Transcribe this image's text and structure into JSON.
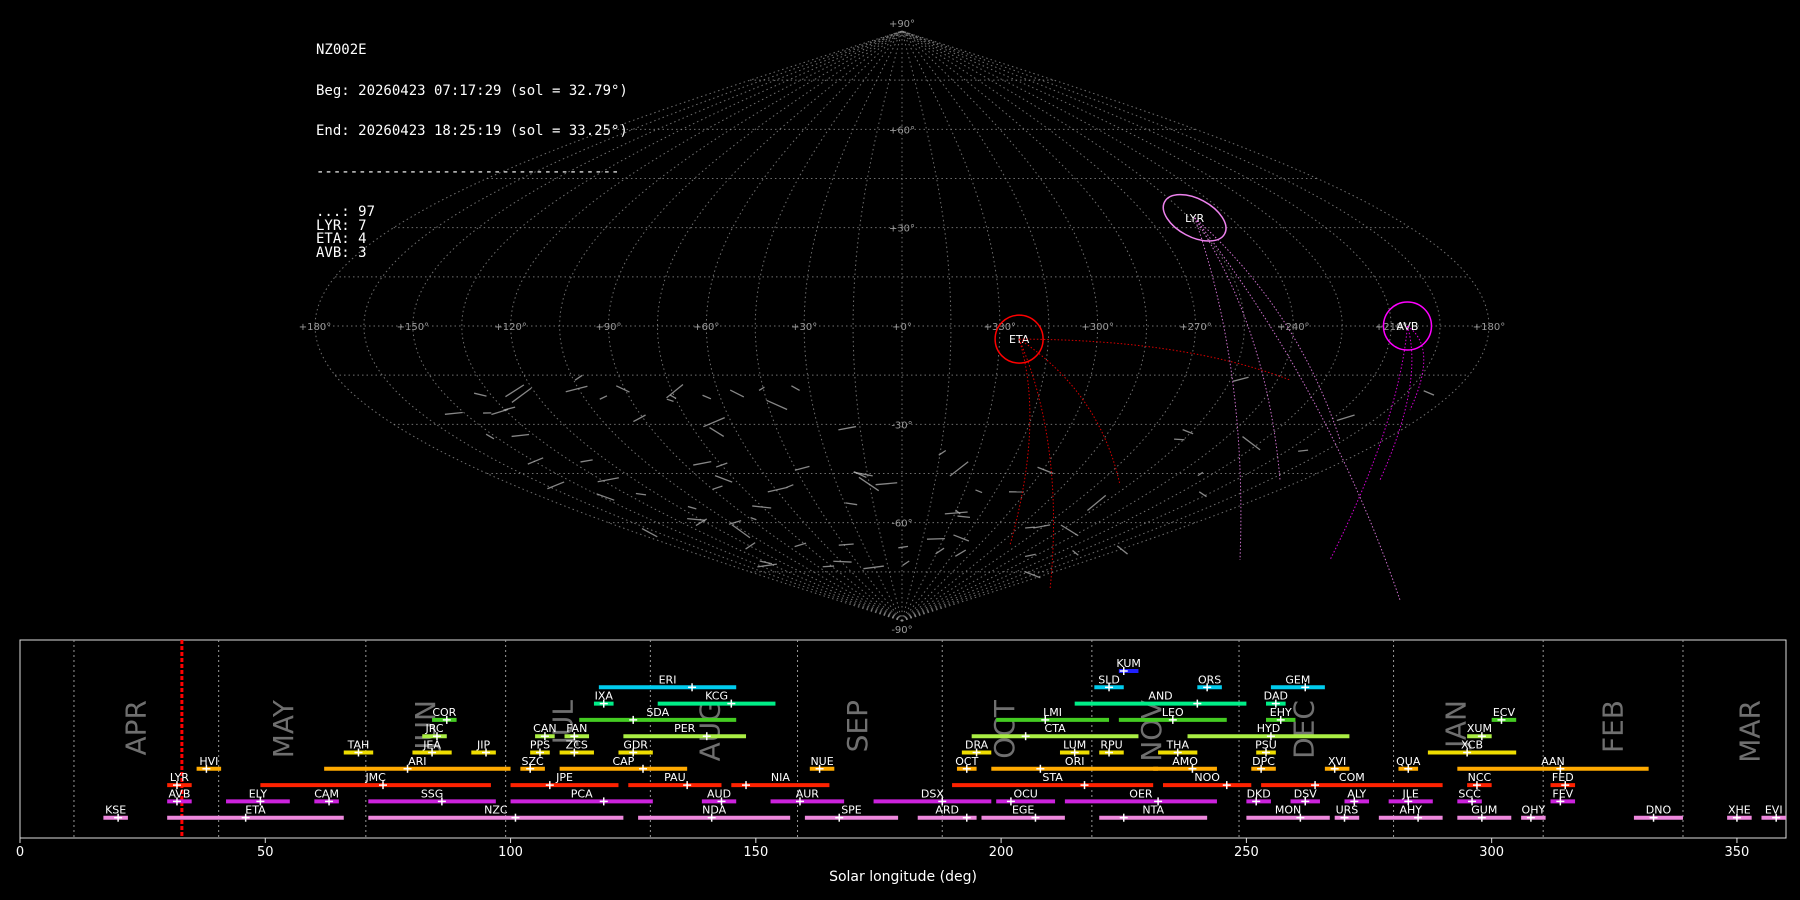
{
  "header": {
    "station": "NZ002E",
    "begin": "Beg: 20260423 07:17:29 (sol = 32.79°)",
    "end": "End: 20260423 18:25:19 (sol = 33.25°)",
    "separator": "------------------------------------",
    "counts": [
      {
        "code": "...",
        "n": 97
      },
      {
        "code": "LYR",
        "n": 7
      },
      {
        "code": "ETA",
        "n": 4
      },
      {
        "code": "AVB",
        "n": 3
      }
    ]
  },
  "colors": {
    "background": "#000000",
    "grid": "#8c8c8c",
    "sporadic": "#b4b4b4",
    "LYR": "#ee82ee",
    "ETA": "#ff0000",
    "AVB": "#ff00ff",
    "current_sol": "#ff0000"
  },
  "chart_data": [
    {
      "type": "scatter",
      "projection": "sinusoidal",
      "grid_lon_labels": [
        "+180°",
        "+150°",
        "+120°",
        "+90°",
        "+60°",
        "+30°",
        "+0°",
        "+330°",
        "+300°",
        "+270°",
        "+240°",
        "+210°",
        "+180°"
      ],
      "grid_lat_labels": [
        "+90°",
        "+60°",
        "+30°",
        "-30°",
        "-60°",
        "-90°"
      ],
      "radiants": [
        {
          "code": "LYR",
          "lon": -107,
          "lat": 33
        },
        {
          "code": "ETA",
          "lon": -36,
          "lat": -4
        },
        {
          "code": "AVB",
          "lon": -155,
          "lat": 0
        }
      ]
    },
    {
      "type": "gantt",
      "xlabel": "Solar longitude (deg)",
      "xlim": [
        0,
        360
      ],
      "xticks": [
        0,
        50,
        100,
        150,
        200,
        250,
        300,
        350
      ],
      "current_sol": 33.0,
      "months": [
        {
          "name": "APR",
          "start": 11,
          "label_at": 24
        },
        {
          "name": "MAY",
          "start": 40.5,
          "label_at": 54
        },
        {
          "name": "JUN",
          "start": 70.5,
          "label_at": 83
        },
        {
          "name": "JUL",
          "start": 99,
          "label_at": 111
        },
        {
          "name": "AUG",
          "start": 128.5,
          "label_at": 141
        },
        {
          "name": "SEP",
          "start": 158.5,
          "label_at": 171
        },
        {
          "name": "OCT",
          "start": 188,
          "label_at": 201
        },
        {
          "name": "NOV",
          "start": 218.5,
          "label_at": 231
        },
        {
          "name": "DEC",
          "start": 248.5,
          "label_at": 262
        },
        {
          "name": "JAN",
          "start": 280,
          "label_at": 293
        },
        {
          "name": "FEB",
          "start": 310.5,
          "label_at": 325
        },
        {
          "name": "MAR",
          "start": 339,
          "label_at": 353
        }
      ],
      "showers": [
        {
          "code": "KUM",
          "start": 224,
          "end": 228,
          "peak": 225,
          "row": 10,
          "color": "#2020ff"
        },
        {
          "code": "SLD",
          "start": 219,
          "end": 225,
          "peak": 222,
          "row": 9,
          "color": "#00ccee"
        },
        {
          "code": "ORS",
          "start": 240,
          "end": 245,
          "peak": 242,
          "row": 9,
          "color": "#00ccee"
        },
        {
          "code": "GEM",
          "start": 255,
          "end": 266,
          "peak": 262,
          "row": 9,
          "color": "#00ccee"
        },
        {
          "code": "ERI",
          "start": 118,
          "end": 146,
          "peak": 137,
          "row": 9,
          "color": "#00ccee"
        },
        {
          "code": "IXA",
          "start": 117,
          "end": 121,
          "peak": 119,
          "row": 8,
          "color": "#00ee88"
        },
        {
          "code": "KCG",
          "start": 130,
          "end": 154,
          "peak": 145,
          "row": 8,
          "color": "#00ee88"
        },
        {
          "code": "AND",
          "start": 215,
          "end": 250,
          "peak": 240,
          "row": 8,
          "color": "#00ee88"
        },
        {
          "code": "DAD",
          "start": 254,
          "end": 258,
          "peak": 256,
          "row": 8,
          "color": "#00ee88"
        },
        {
          "code": "COR",
          "start": 84,
          "end": 89,
          "peak": 87,
          "row": 7,
          "color": "#44cc22"
        },
        {
          "code": "SDA",
          "start": 114,
          "end": 146,
          "peak": 125,
          "row": 7,
          "color": "#44cc22"
        },
        {
          "code": "LMI",
          "start": 199,
          "end": 222,
          "peak": 209,
          "row": 7,
          "color": "#44cc22"
        },
        {
          "code": "LEO",
          "start": 224,
          "end": 246,
          "peak": 235,
          "row": 7,
          "color": "#44cc22"
        },
        {
          "code": "EHY",
          "start": 254,
          "end": 260,
          "peak": 257,
          "row": 7,
          "color": "#44cc22"
        },
        {
          "code": "ECV",
          "start": 300,
          "end": 305,
          "peak": 302,
          "row": 7,
          "color": "#44cc22"
        },
        {
          "code": "JRC",
          "start": 82,
          "end": 87,
          "peak": 85,
          "row": 6,
          "color": "#aaee44"
        },
        {
          "code": "CAN",
          "start": 105,
          "end": 109,
          "peak": 107,
          "row": 6,
          "color": "#aaee44"
        },
        {
          "code": "FAN",
          "start": 111,
          "end": 116,
          "peak": 113,
          "row": 6,
          "color": "#aaee44"
        },
        {
          "code": "PER",
          "start": 123,
          "end": 148,
          "peak": 140,
          "row": 6,
          "color": "#aaee44"
        },
        {
          "code": "CTA",
          "start": 194,
          "end": 228,
          "peak": 205,
          "row": 6,
          "color": "#aaee44"
        },
        {
          "code": "HYD",
          "start": 238,
          "end": 271,
          "peak": 255,
          "row": 6,
          "color": "#aaee44"
        },
        {
          "code": "XUM",
          "start": 295,
          "end": 300,
          "peak": 298,
          "row": 6,
          "color": "#aaee44"
        },
        {
          "code": "TAH",
          "start": 66,
          "end": 72,
          "peak": 69,
          "row": 5,
          "color": "#eedd00"
        },
        {
          "code": "JEA",
          "start": 80,
          "end": 88,
          "peak": 84,
          "row": 5,
          "color": "#eedd00"
        },
        {
          "code": "JIP",
          "start": 92,
          "end": 97,
          "peak": 95,
          "row": 5,
          "color": "#eedd00"
        },
        {
          "code": "PPS",
          "start": 104,
          "end": 108,
          "peak": 106,
          "row": 5,
          "color": "#eedd00"
        },
        {
          "code": "ZCS",
          "start": 110,
          "end": 117,
          "peak": 113,
          "row": 5,
          "color": "#eedd00"
        },
        {
          "code": "GDR",
          "start": 122,
          "end": 129,
          "peak": 125,
          "row": 5,
          "color": "#eedd00"
        },
        {
          "code": "DRA",
          "start": 192,
          "end": 198,
          "peak": 195,
          "row": 5,
          "color": "#eedd00"
        },
        {
          "code": "LUM",
          "start": 212,
          "end": 218,
          "peak": 215,
          "row": 5,
          "color": "#eedd00"
        },
        {
          "code": "RPU",
          "start": 220,
          "end": 225,
          "peak": 222,
          "row": 5,
          "color": "#eedd00"
        },
        {
          "code": "THA",
          "start": 232,
          "end": 240,
          "peak": 236,
          "row": 5,
          "color": "#eedd00"
        },
        {
          "code": "PSU",
          "start": 252,
          "end": 256,
          "peak": 254,
          "row": 5,
          "color": "#eedd00"
        },
        {
          "code": "XCB",
          "start": 287,
          "end": 305,
          "peak": 295,
          "row": 5,
          "color": "#eedd00"
        },
        {
          "code": "HVI",
          "start": 36,
          "end": 41,
          "peak": 38,
          "row": 4,
          "color": "#ffaa00"
        },
        {
          "code": "ARI",
          "start": 62,
          "end": 100,
          "peak": 79,
          "row": 4,
          "color": "#ffaa00"
        },
        {
          "code": "SZC",
          "start": 102,
          "end": 107,
          "peak": 104,
          "row": 4,
          "color": "#ffaa00"
        },
        {
          "code": "CAP",
          "start": 110,
          "end": 136,
          "peak": 127,
          "row": 4,
          "color": "#ffaa00"
        },
        {
          "code": "NUE",
          "start": 161,
          "end": 166,
          "peak": 163,
          "row": 4,
          "color": "#ffaa00"
        },
        {
          "code": "OCT",
          "start": 191,
          "end": 195,
          "peak": 193,
          "row": 4,
          "color": "#ffaa00"
        },
        {
          "code": "ORI",
          "start": 198,
          "end": 232,
          "peak": 208,
          "row": 4,
          "color": "#ffaa00"
        },
        {
          "code": "AMO",
          "start": 231,
          "end": 244,
          "peak": 239,
          "row": 4,
          "color": "#ffaa00"
        },
        {
          "code": "DPC",
          "start": 251,
          "end": 256,
          "peak": 253,
          "row": 4,
          "color": "#ffaa00"
        },
        {
          "code": "XVI",
          "start": 266,
          "end": 271,
          "peak": 268,
          "row": 4,
          "color": "#ffaa00"
        },
        {
          "code": "QUA",
          "start": 281,
          "end": 285,
          "peak": 283,
          "row": 4,
          "color": "#ffaa00"
        },
        {
          "code": "AAN",
          "start": 293,
          "end": 332,
          "peak": 314,
          "row": 4,
          "color": "#ffaa00"
        },
        {
          "code": "LYR",
          "start": 30,
          "end": 35,
          "peak": 32,
          "row": 3,
          "color": "#ff2200"
        },
        {
          "code": "JMC",
          "start": 49,
          "end": 96,
          "peak": 74,
          "row": 3,
          "color": "#ff2200"
        },
        {
          "code": "JPE",
          "start": 100,
          "end": 122,
          "peak": 108,
          "row": 3,
          "color": "#ff2200"
        },
        {
          "code": "PAU",
          "start": 124,
          "end": 143,
          "peak": 136,
          "row": 3,
          "color": "#ff2200"
        },
        {
          "code": "NIA",
          "start": 145,
          "end": 165,
          "peak": 148,
          "row": 3,
          "color": "#ff2200"
        },
        {
          "code": "STA",
          "start": 190,
          "end": 231,
          "peak": 217,
          "row": 3,
          "color": "#ff2200"
        },
        {
          "code": "NOO",
          "start": 233,
          "end": 251,
          "peak": 246,
          "row": 3,
          "color": "#ff2200"
        },
        {
          "code": "COM",
          "start": 253,
          "end": 290,
          "peak": 264,
          "row": 3,
          "color": "#ff2200"
        },
        {
          "code": "NCC",
          "start": 295,
          "end": 300,
          "peak": 297,
          "row": 3,
          "color": "#ff2200"
        },
        {
          "code": "FED",
          "start": 312,
          "end": 317,
          "peak": 315,
          "row": 3,
          "color": "#ff2200"
        },
        {
          "code": "AVB",
          "start": 30,
          "end": 35,
          "peak": 32,
          "row": 2,
          "color": "#cc22dd"
        },
        {
          "code": "ELY",
          "start": 42,
          "end": 55,
          "peak": 49,
          "row": 2,
          "color": "#cc22dd"
        },
        {
          "code": "CAM",
          "start": 60,
          "end": 65,
          "peak": 63,
          "row": 2,
          "color": "#cc22dd"
        },
        {
          "code": "SSG",
          "start": 71,
          "end": 97,
          "peak": 86,
          "row": 2,
          "color": "#cc22dd"
        },
        {
          "code": "PCA",
          "start": 100,
          "end": 129,
          "peak": 119,
          "row": 2,
          "color": "#cc22dd"
        },
        {
          "code": "AUD",
          "start": 139,
          "end": 146,
          "peak": 143,
          "row": 2,
          "color": "#cc22dd"
        },
        {
          "code": "AUR",
          "start": 153,
          "end": 168,
          "peak": 159,
          "row": 2,
          "color": "#cc22dd"
        },
        {
          "code": "DSX",
          "start": 174,
          "end": 198,
          "peak": 188,
          "row": 2,
          "color": "#cc22dd"
        },
        {
          "code": "OCU",
          "start": 199,
          "end": 211,
          "peak": 202,
          "row": 2,
          "color": "#cc22dd"
        },
        {
          "code": "OER",
          "start": 213,
          "end": 244,
          "peak": 232,
          "row": 2,
          "color": "#cc22dd"
        },
        {
          "code": "DKD",
          "start": 250,
          "end": 255,
          "peak": 252,
          "row": 2,
          "color": "#cc22dd"
        },
        {
          "code": "DSV",
          "start": 259,
          "end": 265,
          "peak": 262,
          "row": 2,
          "color": "#cc22dd"
        },
        {
          "code": "ALY",
          "start": 270,
          "end": 275,
          "peak": 272,
          "row": 2,
          "color": "#cc22dd"
        },
        {
          "code": "JLE",
          "start": 279,
          "end": 288,
          "peak": 283,
          "row": 2,
          "color": "#cc22dd"
        },
        {
          "code": "SCC",
          "start": 293,
          "end": 298,
          "peak": 296,
          "row": 2,
          "color": "#cc22dd"
        },
        {
          "code": "FEV",
          "start": 312,
          "end": 317,
          "peak": 314,
          "row": 2,
          "color": "#cc22dd"
        },
        {
          "code": "KSE",
          "start": 17,
          "end": 22,
          "peak": 20,
          "row": 1,
          "color": "#ee88dd"
        },
        {
          "code": "ETA",
          "start": 30,
          "end": 66,
          "peak": 46,
          "row": 1,
          "color": "#ee88dd"
        },
        {
          "code": "NZC",
          "start": 71,
          "end": 123,
          "peak": 101,
          "row": 1,
          "color": "#ee88dd"
        },
        {
          "code": "NDA",
          "start": 126,
          "end": 157,
          "peak": 141,
          "row": 1,
          "color": "#ee88dd"
        },
        {
          "code": "SPE",
          "start": 160,
          "end": 179,
          "peak": 167,
          "row": 1,
          "color": "#ee88dd"
        },
        {
          "code": "ARD",
          "start": 183,
          "end": 195,
          "peak": 193,
          "row": 1,
          "color": "#ee88dd"
        },
        {
          "code": "EGE",
          "start": 196,
          "end": 213,
          "peak": 207,
          "row": 1,
          "color": "#ee88dd"
        },
        {
          "code": "NTA",
          "start": 220,
          "end": 242,
          "peak": 225,
          "row": 1,
          "color": "#ee88dd"
        },
        {
          "code": "MON",
          "start": 250,
          "end": 267,
          "peak": 261,
          "row": 1,
          "color": "#ee88dd"
        },
        {
          "code": "URS",
          "start": 268,
          "end": 273,
          "peak": 270,
          "row": 1,
          "color": "#ee88dd"
        },
        {
          "code": "AHY",
          "start": 277,
          "end": 290,
          "peak": 285,
          "row": 1,
          "color": "#ee88dd"
        },
        {
          "code": "GUM",
          "start": 293,
          "end": 304,
          "peak": 298,
          "row": 1,
          "color": "#ee88dd"
        },
        {
          "code": "OHY",
          "start": 306,
          "end": 311,
          "peak": 308,
          "row": 1,
          "color": "#ee88dd"
        },
        {
          "code": "DNO",
          "start": 329,
          "end": 339,
          "peak": 333,
          "row": 1,
          "color": "#ee88dd"
        },
        {
          "code": "XHE",
          "start": 348,
          "end": 353,
          "peak": 350,
          "row": 1,
          "color": "#ee88dd"
        },
        {
          "code": "EVI",
          "start": 355,
          "end": 360,
          "peak": 358,
          "row": 1,
          "color": "#ee88dd"
        }
      ]
    }
  ]
}
